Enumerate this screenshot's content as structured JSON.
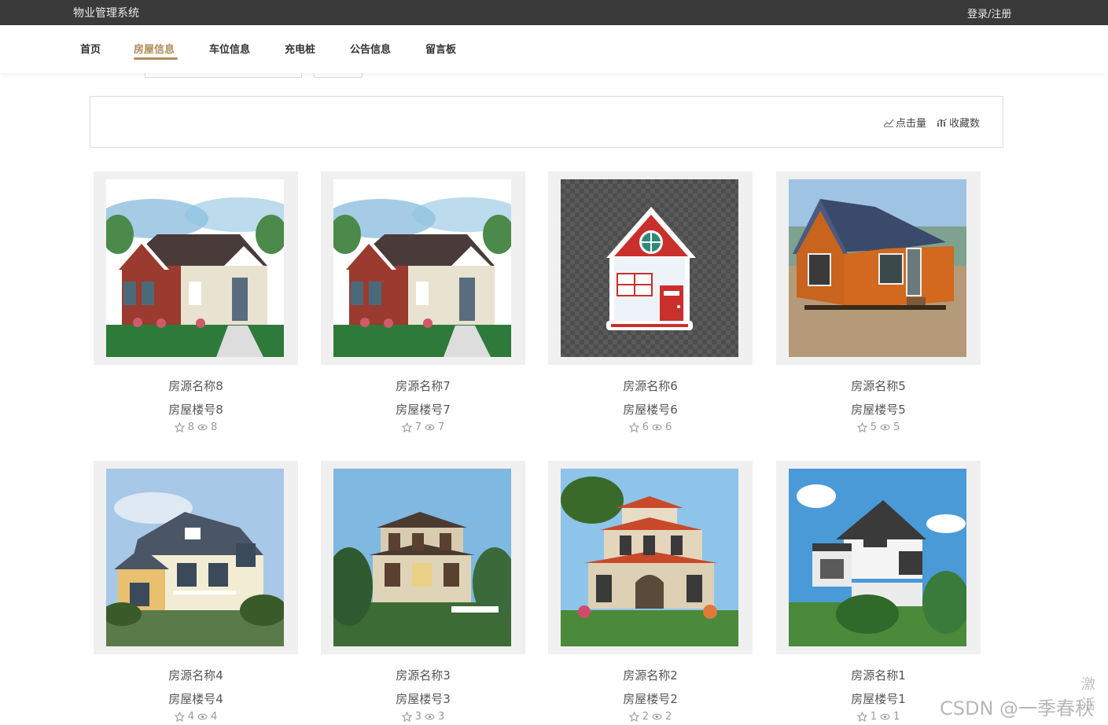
{
  "topbar": {
    "title": "物业管理系统",
    "login": "登录/注册"
  },
  "nav": [
    {
      "label": "首页",
      "active": false
    },
    {
      "label": "房屋信息",
      "active": true
    },
    {
      "label": "车位信息",
      "active": false
    },
    {
      "label": "充电桩",
      "active": false
    },
    {
      "label": "公告信息",
      "active": false
    },
    {
      "label": "留言板",
      "active": false
    }
  ],
  "sort": {
    "clicks": "点击量",
    "favorites": "收藏数"
  },
  "colors": {
    "accent": "#b08c5a",
    "topbar": "#3a3a3a"
  },
  "cards": [
    {
      "name": "房源名称8",
      "number": "房屋楼号8",
      "fav": "8",
      "views": "8",
      "image": "red-brick-cottage"
    },
    {
      "name": "房源名称7",
      "number": "房屋楼号7",
      "fav": "7",
      "views": "7",
      "image": "red-brick-cottage"
    },
    {
      "name": "房源名称6",
      "number": "房屋楼号6",
      "fav": "6",
      "views": "6",
      "image": "cartoon-house"
    },
    {
      "name": "房源名称5",
      "number": "房屋楼号5",
      "fav": "5",
      "views": "5",
      "image": "wooden-cabin"
    },
    {
      "name": "房源名称4",
      "number": "房屋楼号4",
      "fav": "4",
      "views": "4",
      "image": "cream-villa"
    },
    {
      "name": "房源名称3",
      "number": "房屋楼号3",
      "fav": "3",
      "views": "3",
      "image": "brown-villa"
    },
    {
      "name": "房源名称2",
      "number": "房屋楼号2",
      "fav": "2",
      "views": "2",
      "image": "european-villa"
    },
    {
      "name": "房源名称1",
      "number": "房屋楼号1",
      "fav": "1",
      "views": "1",
      "image": "white-modern-villa"
    }
  ],
  "watermark": "CSDN @一季春秋",
  "activate_text": "激活"
}
